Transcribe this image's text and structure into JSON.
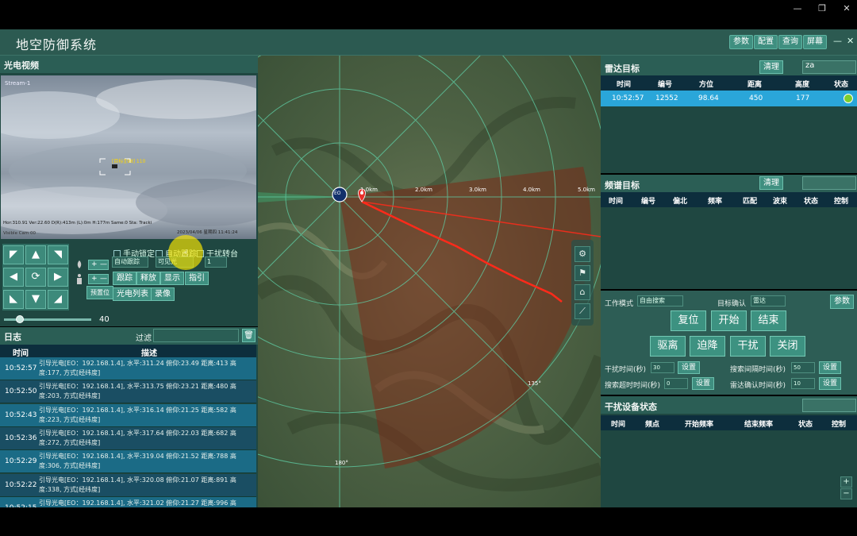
{
  "app": {
    "title": "地空防御系统"
  },
  "window_controls": {
    "minimize": "—",
    "restore": "❐",
    "close": "✕"
  },
  "top_buttons": [
    "参数",
    "配置",
    "查询",
    "屏幕"
  ],
  "top_controls": {
    "minimize": "—",
    "close": "✕"
  },
  "eo": {
    "title": "光电视频",
    "overlay_topleft": "Stream-1",
    "target_label": "[目标][98] 110",
    "status_line": "Hor:310.91 Ver:22.60 D(R):413m (L):0m H:177m Same:0 Sta: Tracki",
    "timestamp": "2023/04/06 星期四 11:41:24",
    "bottom_left": "Visible Cam 00"
  },
  "ptz": {
    "up_left": "◤",
    "up": "▲",
    "up_right": "◥",
    "left": "◀",
    "home": "⟳",
    "right": "▶",
    "down_left": "◣",
    "down": "▼",
    "down_right": "◢"
  },
  "eo_controls": {
    "zoom_minus": "—",
    "zoom_plus": "+",
    "focus_minus": "—",
    "focus_plus": "+",
    "preset": "预置位",
    "manual_lock": "手动锁定",
    "auto_track": "自动跟踪",
    "jam_turntable": "干扰转台",
    "track_mode": "自动跟踪",
    "cam_type": "可见光",
    "cam_num": "1",
    "btn_track": "跟踪",
    "btn_release": "释放",
    "btn_display": "显示",
    "btn_guide": "指引",
    "btn_eo_list": "光电列表",
    "btn_record": "录像",
    "slider_value": "40",
    "slider_fraction": 0.18
  },
  "log": {
    "title": "日志",
    "filter_label": "过滤",
    "col_time": "时间",
    "col_desc": "描述",
    "rows": [
      {
        "time": "10:52:57",
        "text": "引导光电[EO：192.168.1.4], 水平:311.24 俯仰:23.49 距离:413 高度:177, 方式[经纬度]"
      },
      {
        "time": "10:52:50",
        "text": "引导光电[EO：192.168.1.4], 水平:313.75 俯仰:23.21 距离:480 高度:203, 方式[经纬度]"
      },
      {
        "time": "10:52:43",
        "text": "引导光电[EO：192.168.1.4], 水平:316.14 俯仰:21.25 距离:582 高度:223, 方式[经纬度]"
      },
      {
        "time": "10:52:36",
        "text": "引导光电[EO：192.168.1.4], 水平:317.64 俯仰:22.03 距离:682 高度:272, 方式[经纬度]"
      },
      {
        "time": "10:52:29",
        "text": "引导光电[EO：192.168.1.4], 水平:319.04 俯仰:21.52 距离:788 高度:306, 方式[经纬度]"
      },
      {
        "time": "10:52:22",
        "text": "引导光电[EO：192.168.1.4], 水平:320.08 俯仰:21.07 距离:891 高度:338, 方式[经纬度]"
      },
      {
        "time": "10:52:15",
        "text": "引导光电[EO：192.168.1.4], 水平:321.02 俯仰:21.27 距离:996 高"
      }
    ]
  },
  "map": {
    "range_labels": [
      "1.0km",
      "2.0km",
      "3.0km",
      "4.0km",
      "5.0km"
    ],
    "bearing_135": "135°",
    "bearing_180": "180°",
    "station_label": "EO"
  },
  "map_tools": [
    "⚙",
    "⚑",
    "⌂",
    "⟋"
  ],
  "zoom": {
    "plus": "+",
    "minus": "−"
  },
  "radar": {
    "title": "雷达目标",
    "clear": "清理",
    "dropdown": "za",
    "columns": [
      "时间",
      "编号",
      "方位",
      "距离",
      "高度",
      "状态"
    ],
    "rows": [
      {
        "time": "10:52:57",
        "id": "12552",
        "azimuth": "98.64",
        "distance": "450",
        "height": "177"
      }
    ],
    "status_color": "#7ccd2e"
  },
  "spectrum": {
    "title": "频谱目标",
    "clear": "清理",
    "columns": [
      "时间",
      "编号",
      "偏北",
      "频率",
      "匹配",
      "波束",
      "状态",
      "控制"
    ]
  },
  "work": {
    "mode_label": "工作模式",
    "mode_value": "自由搜索",
    "confirm_label": "目标确认",
    "confirm_value": "雷达",
    "params": "参数",
    "reset": "复位",
    "start": "开始",
    "end": "结束",
    "expel": "驱离",
    "force_land": "迫降",
    "jam": "干扰",
    "off": "关闭",
    "jam_time_label": "干扰时间(秒)",
    "jam_time_value": "30",
    "search_interval_label": "搜索间隔时间(秒)",
    "search_interval_value": "50",
    "search_timeout_label": "搜索超时时间(秒)",
    "search_timeout_value": "0",
    "radar_confirm_label": "雷达确认时间(秒)",
    "radar_confirm_value": "10",
    "set": "设置"
  },
  "jammer": {
    "title": "干扰设备状态",
    "columns": [
      "时间",
      "频点",
      "开始频率",
      "结束频率",
      "状态",
      "控制"
    ]
  }
}
